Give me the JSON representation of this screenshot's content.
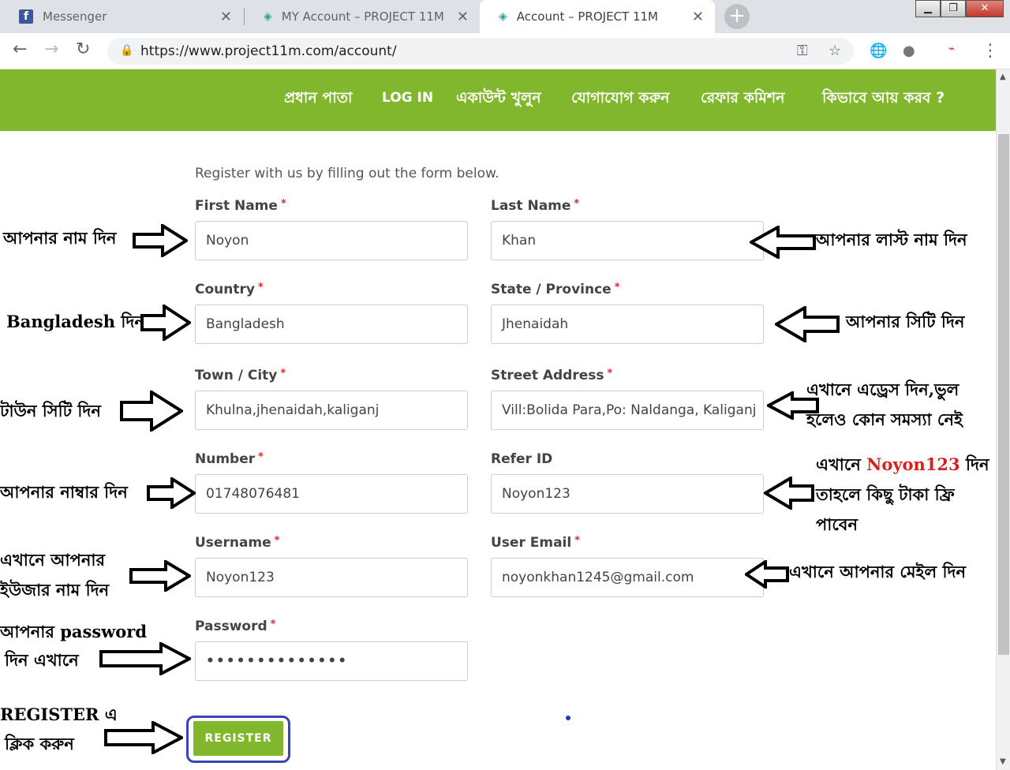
{
  "browser": {
    "tabs": [
      {
        "title": "Messenger",
        "icon": "facebook-icon"
      },
      {
        "title": "MY Account – PROJECT 11M",
        "icon": "project11m-icon"
      },
      {
        "title": "Account – PROJECT 11M",
        "icon": "project11m-icon"
      }
    ],
    "url": "https://www.project11m.com/account/"
  },
  "nav": {
    "items": [
      "প্রধান পাতা",
      "LOG IN",
      "একাউন্ট খুলুন",
      "যোগাযোগ করুন",
      "রেফার কমিশন",
      "কিভাবে আয় করব ?"
    ]
  },
  "form": {
    "intro": "Register with us by filling out the form below.",
    "first_name": {
      "label": "First Name",
      "value": "Noyon"
    },
    "last_name": {
      "label": "Last Name",
      "value": "Khan"
    },
    "country": {
      "label": "Country",
      "value": "Bangladesh"
    },
    "state": {
      "label": "State / Province",
      "value": "Jhenaidah"
    },
    "city": {
      "label": "Town / City",
      "value": "Khulna,jhenaidah,kaliganj"
    },
    "street": {
      "label": "Street Address",
      "value": "Vill:Bolida Para,Po: Naldanga, Kaliganj"
    },
    "number": {
      "label": "Number",
      "value": "01748076481"
    },
    "refer": {
      "label": "Refer ID",
      "value": "Noyon123"
    },
    "username": {
      "label": "Username",
      "value": "Noyon123"
    },
    "email": {
      "label": "User Email",
      "value": "noyonkhan1245@gmail.com"
    },
    "password": {
      "label": "Password",
      "value": "••••••••••••••"
    },
    "required_mark": "*",
    "register_label": "REGISTER"
  },
  "annotations": {
    "first_name": "আপনার নাম দিন",
    "last_name": "আপনার লাস্ট নাম দিন",
    "country": "Bangladesh দিন",
    "state": "আপনার সিটি দিন",
    "city": "টাউন সিটি দিন",
    "street_1": "এখানে এড্রেস দিন,ভুল",
    "street_2": "হলেও কোন সমস্যা নেই",
    "number": "আপনার নাম্বার দিন",
    "refer_1a": "এখানে ",
    "refer_1b": "Noyon123",
    "refer_1c": " দিন",
    "refer_2": "তাহলে কিছু টাকা ফ্রি",
    "refer_3": "পাবেন",
    "username_1": "এখানে আপনার",
    "username_2": "ইউজার নাম দিন",
    "email": "এখানে আপনার মেইল দিন",
    "password_1": "আপনার password",
    "password_2": "দিন এখানে",
    "register_1": "REGISTER এ",
    "register_2": "ক্লিক করুন"
  },
  "colors": {
    "nav_green": "#81b72c",
    "required_red": "#d32f2f",
    "highlight_blue": "#3b44b5"
  }
}
